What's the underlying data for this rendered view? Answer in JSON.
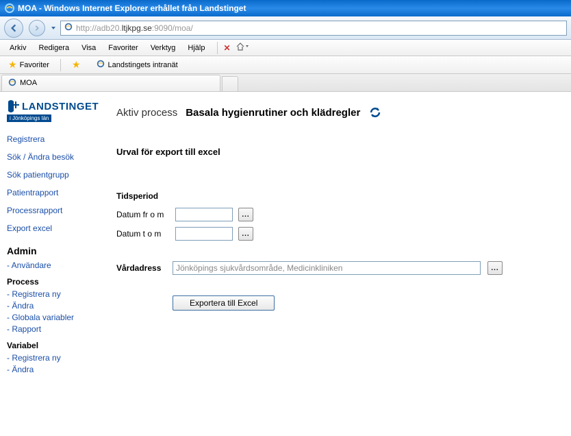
{
  "window": {
    "title": "MOA - Windows Internet Explorer erhållet från Landstinget"
  },
  "address": {
    "prefix": "http://adb20.",
    "host": "ltjkpg.se",
    "suffix": ":9090/moa/"
  },
  "menu": {
    "arkiv": "Arkiv",
    "redigera": "Redigera",
    "visa": "Visa",
    "favoriter": "Favoriter",
    "verktyg": "Verktyg",
    "hjalp": "Hjälp"
  },
  "favbar": {
    "favoriter": "Favoriter",
    "intranat": "Landstingets intranät"
  },
  "tab": {
    "label": "MOA"
  },
  "logo": {
    "main": "LANDSTINGET",
    "sub": "i Jönköpings län"
  },
  "sidebar": {
    "links": {
      "registrera": "Registrera",
      "sok_andra": "Sök / Ändra besök",
      "sok_patient": "Sök patientgrupp",
      "patientrapport": "Patientrapport",
      "processrapport": "Processrapport",
      "export": "Export excel"
    },
    "admin_title": "Admin",
    "anvandare": "- Användare",
    "process_title": "Process",
    "process_links": {
      "registrera_ny": "- Registrera ny",
      "andra": "- Ändra",
      "globala": "- Globala variabler",
      "rapport": "- Rapport"
    },
    "variabel_title": "Variabel",
    "variabel_links": {
      "registrera_ny": "- Registrera ny",
      "andra": "- Ändra"
    }
  },
  "main": {
    "aktiv_process": "Aktiv process",
    "process_name": "Basala hygienrutiner och klädregler",
    "heading": "Urval för export till excel",
    "tidsperiod": "Tidsperiod",
    "datum_from": "Datum fr o m",
    "datum_tom": "Datum t o m",
    "vardadress": "Vårdadress",
    "vardadress_value": "Jönköpings sjukvårdsområde, Medicinkliniken",
    "export_btn": "Exportera till Excel",
    "picker": "..."
  }
}
